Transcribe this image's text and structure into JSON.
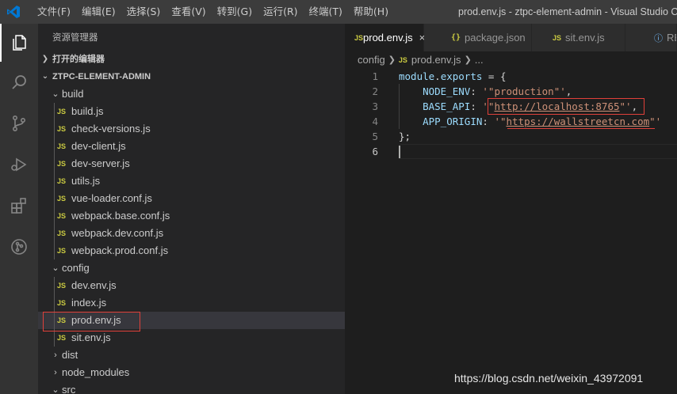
{
  "titlebar": {
    "menu": [
      "文件(F)",
      "编辑(E)",
      "选择(S)",
      "查看(V)",
      "转到(G)",
      "运行(R)",
      "终端(T)",
      "帮助(H)"
    ],
    "window_title": "prod.env.js - ztpc-element-admin - Visual Studio Code"
  },
  "activitybar": {
    "icons": [
      "explorer-icon",
      "search-icon",
      "source-control-icon",
      "run-debug-icon",
      "extensions-icon",
      "git-icon"
    ]
  },
  "sidebar": {
    "header": "资源管理器",
    "open_editors": "打开的编辑器",
    "project": "ZTPC-ELEMENT-ADMIN",
    "tree": [
      {
        "type": "folder",
        "label": "build",
        "expanded": true
      },
      {
        "type": "file",
        "label": "build.js"
      },
      {
        "type": "file",
        "label": "check-versions.js"
      },
      {
        "type": "file",
        "label": "dev-client.js"
      },
      {
        "type": "file",
        "label": "dev-server.js"
      },
      {
        "type": "file",
        "label": "utils.js"
      },
      {
        "type": "file",
        "label": "vue-loader.conf.js"
      },
      {
        "type": "file",
        "label": "webpack.base.conf.js"
      },
      {
        "type": "file",
        "label": "webpack.dev.conf.js"
      },
      {
        "type": "file",
        "label": "webpack.prod.conf.js"
      },
      {
        "type": "folder",
        "label": "config",
        "expanded": true
      },
      {
        "type": "file",
        "label": "dev.env.js"
      },
      {
        "type": "file",
        "label": "index.js"
      },
      {
        "type": "file",
        "label": "prod.env.js",
        "selected": true
      },
      {
        "type": "file",
        "label": "sit.env.js"
      },
      {
        "type": "folder",
        "label": "dist",
        "expanded": false
      },
      {
        "type": "folder",
        "label": "node_modules",
        "expanded": false
      },
      {
        "type": "folder",
        "label": "src",
        "expanded": true
      }
    ],
    "js_badge": "JS"
  },
  "editor": {
    "tabs": [
      {
        "label": "prod.env.js",
        "badge": "JS",
        "active": true,
        "close": "×"
      },
      {
        "label": "package.json",
        "badge": "{}",
        "active": false
      },
      {
        "label": "sit.env.js",
        "badge": "JS",
        "active": false
      },
      {
        "label": "README.md",
        "badge": "ⓘ",
        "active": false
      }
    ],
    "breadcrumb": {
      "folder": "config",
      "file_badge": "JS",
      "file": "prod.env.js",
      "more": "..."
    },
    "line_numbers": [
      "1",
      "2",
      "3",
      "4",
      "5",
      "6"
    ],
    "code": {
      "l1_obj": "module",
      "l1_dot": ".",
      "l1_prop": "exports",
      "l1_rest": " = {",
      "l2_key": "NODE_ENV",
      "l2_colon": ": ",
      "l2_val": "'\"production\"'",
      "l2_comma": ",",
      "l3_key": "BASE_API",
      "l3_colon": ": ",
      "l3_q1": "'\"",
      "l3_url": "http://localhost:8765",
      "l3_q2": "\"'",
      "l3_comma": ",",
      "l4_key": "APP_ORIGIN",
      "l4_colon": ": ",
      "l4_q1": "'\"",
      "l4_url": "https://wallstreetcn.com",
      "l4_q2": "\"'",
      "l5": "};"
    }
  },
  "watermark": "https://blog.csdn.net/weixin_43972091"
}
